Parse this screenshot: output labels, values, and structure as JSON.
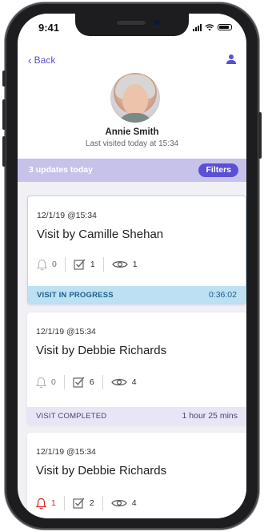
{
  "status_bar": {
    "time": "9:41"
  },
  "nav": {
    "back_label": "Back"
  },
  "profile": {
    "name": "Annie Smith",
    "last_visited": "Last visited today at 15:34"
  },
  "updates": {
    "summary": "3 updates today",
    "filters_label": "Filters"
  },
  "visits": [
    {
      "date": "12/1/19 @15:34",
      "title": "Visit by Camille Shehan",
      "alerts": "0",
      "tasks": "1",
      "views": "1",
      "status": "VISIT IN PROGRESS",
      "duration": "0:36:02"
    },
    {
      "date": "12/1/19 @15:34",
      "title": "Visit by Debbie Richards",
      "alerts": "0",
      "tasks": "6",
      "views": "4",
      "status": "VISIT COMPLETED",
      "duration": "1 hour 25 mins"
    },
    {
      "date": "12/1/19 @15:34",
      "title": "Visit by Debbie Richards",
      "alerts": "1",
      "tasks": "2",
      "views": "4"
    }
  ],
  "colors": {
    "accent": "#5b4fd6",
    "updates_bar": "#c7c2ea",
    "in_progress": "#bde0f3",
    "completed": "#e7e5f6",
    "alert": "#e02424"
  }
}
